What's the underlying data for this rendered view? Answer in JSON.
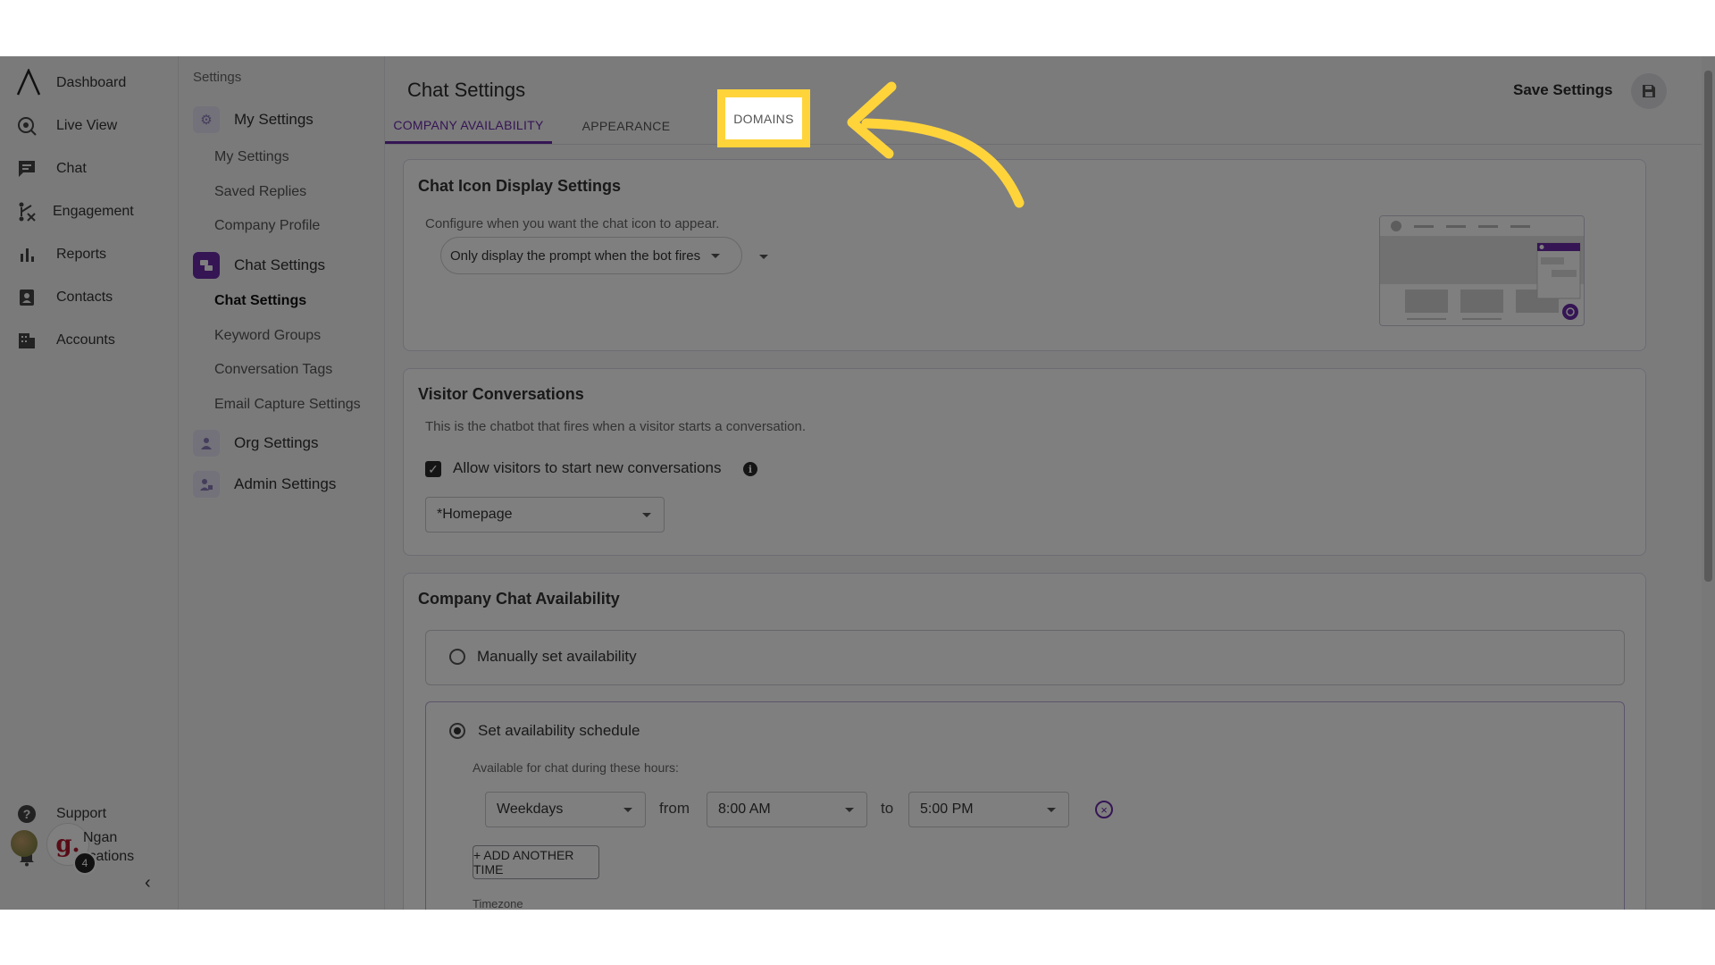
{
  "nav": {
    "items": [
      {
        "label": "Dashboard",
        "icon": "logo-icon"
      },
      {
        "label": "Live View",
        "icon": "live-view-icon"
      },
      {
        "label": "Chat",
        "icon": "chat-icon"
      },
      {
        "label": "Engagement",
        "icon": "engagement-icon"
      },
      {
        "label": "Reports",
        "icon": "reports-icon"
      },
      {
        "label": "Contacts",
        "icon": "contacts-icon"
      },
      {
        "label": "Accounts",
        "icon": "accounts-icon"
      }
    ],
    "support_label": "Support",
    "notifications_label": "Notifications",
    "user_name": "Ngan",
    "avatar_letter": "g.",
    "badge_count": "4"
  },
  "settings_nav": {
    "title": "Settings",
    "my_settings_group": "My Settings",
    "my_settings_items": [
      "My Settings",
      "Saved Replies",
      "Company Profile"
    ],
    "chat_settings_group": "Chat Settings",
    "chat_settings_items": [
      "Chat Settings",
      "Keyword Groups",
      "Conversation Tags",
      "Email Capture Settings"
    ],
    "org_settings_group": "Org Settings",
    "admin_settings_group": "Admin Settings"
  },
  "header": {
    "title": "Chat Settings",
    "save_label": "Save Settings"
  },
  "tabs": [
    "COMPANY AVAILABILITY",
    "APPEARANCE",
    "DOMAINS"
  ],
  "chat_icon_card": {
    "title": "Chat Icon Display Settings",
    "desc": "Configure when you want the chat icon to appear.",
    "select_value": "Only display the prompt when the bot fires"
  },
  "visitor_card": {
    "title": "Visitor Conversations",
    "desc": "This is the chatbot that fires when a visitor starts a conversation.",
    "checkbox_label": "Allow visitors to start new conversations",
    "bot_select": "*Homepage"
  },
  "availability_card": {
    "title": "Company Chat Availability",
    "manual_label": "Manually set availability",
    "schedule_label": "Set availability schedule",
    "hours_desc": "Available for chat during these hours:",
    "days_select": "Weekdays",
    "from_word": "from",
    "from_time": "8:00 AM",
    "to_word": "to",
    "to_time": "5:00 PM",
    "add_label": "+ ADD ANOTHER TIME",
    "timezone_label": "Timezone"
  },
  "colors": {
    "accent": "#6a2aa8",
    "highlight": "#ffd43b"
  }
}
